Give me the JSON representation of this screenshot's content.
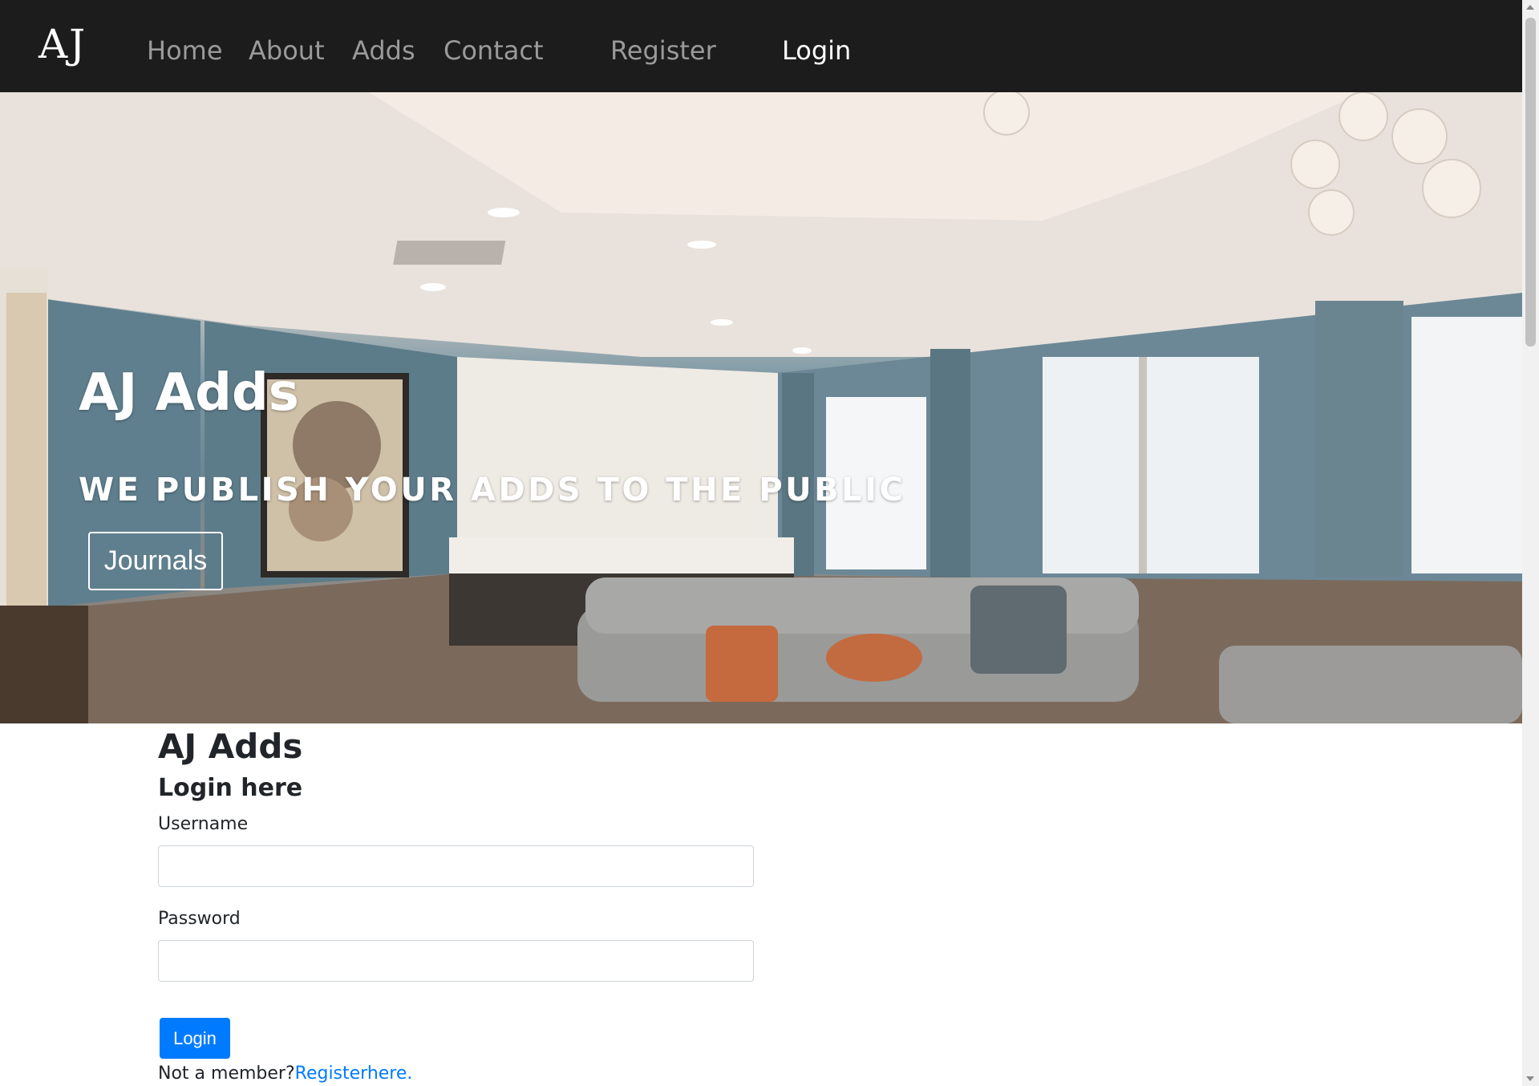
{
  "nav": {
    "brand": "AJ",
    "links": [
      "Home",
      "About",
      "Adds",
      "Contact",
      "Register",
      "Login"
    ],
    "active": "Login"
  },
  "hero": {
    "title": "AJ Adds",
    "subtitle": "WE PUBLISH YOUR ADDS TO THE PUBLIC",
    "button_label": "Journals",
    "image": "living-room-interior-photo"
  },
  "login": {
    "title": "AJ Adds",
    "subtitle": "Login here",
    "username_label": "Username",
    "username_value": "",
    "password_label": "Password",
    "password_value": "",
    "submit_label": "Login",
    "register_prompt": "Not a member?",
    "register_link": "Registerhere."
  },
  "colors": {
    "navbar_bg": "#1c1c1c",
    "nav_link": "#9a9a9a",
    "nav_active": "#ffffff",
    "primary": "#007bff",
    "link": "#007bff"
  }
}
